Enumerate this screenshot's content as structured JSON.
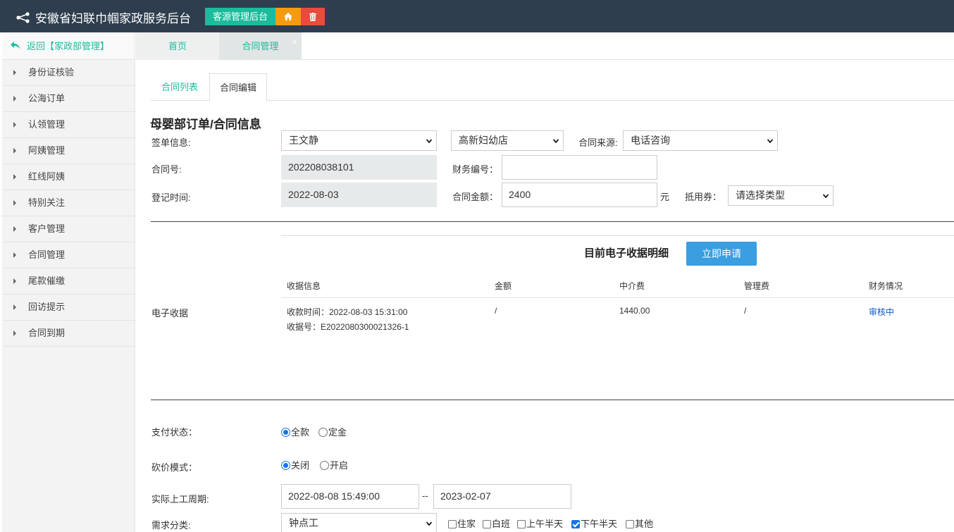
{
  "header": {
    "app_title": "安徽省妇联巾帼家政服务后台",
    "main_tag": "客源管理后台",
    "home_icon": "home-icon",
    "delete_icon": "trash-icon",
    "bg_color": "#2f3e4e"
  },
  "sidebar": {
    "back_label": "返回【家政部管理】",
    "items": [
      "身份证核验",
      "公海订单",
      "认领管理",
      "阿姨管理",
      "红线阿姨",
      "特别关注",
      "客户管理",
      "合同管理",
      "尾款催缴",
      "回访提示",
      "合同到期"
    ]
  },
  "tabs": [
    {
      "label": "首页"
    },
    {
      "label": "合同管理",
      "close": "×"
    }
  ],
  "subtabs": [
    {
      "label": "合同列表"
    },
    {
      "label": "合同编辑"
    }
  ],
  "form": {
    "title": "母婴部订单/合同信息",
    "sign_info_label": "签单信息:",
    "signer": "王文静",
    "store": "高新妇幼店",
    "source_label": "合同来源:",
    "source": "电话咨询",
    "contract_no_label": "合同号:",
    "contract_no": "202208038101",
    "finance_no_label": "财务编号：",
    "finance_no": "",
    "reg_time_label": "登记时间:",
    "reg_time": "2022-08-03",
    "amount_label": "合同金额：",
    "amount": "2400",
    "amount_unit": "元",
    "voucher_label": "抵用券：",
    "voucher": "请选择类型"
  },
  "receipt": {
    "section_label": "电子收据",
    "title": "目前电子收据明细",
    "apply_button": "立即申请",
    "columns": [
      "收据信息",
      "金额",
      "中介费",
      "管理费",
      "财务情况"
    ],
    "row": {
      "info_line1": "收款时间：2022-08-03 15:31:00",
      "info_line2": "收据号：E2022080300021326-1",
      "amount": "/",
      "agent_fee": "1440.00",
      "mgmt_fee": "/",
      "status": "审核中"
    }
  },
  "payment": {
    "label": "支付状态：",
    "options": [
      "全款",
      "定金"
    ],
    "selected": "全款"
  },
  "bargain": {
    "label": "砍价模式：",
    "options": [
      "关闭",
      "开启"
    ],
    "selected": "关闭"
  },
  "period": {
    "label": "实际上工周期:",
    "start": "2022-08-08 15:49:00",
    "separator": "--",
    "end": "2023-02-07"
  },
  "demand": {
    "label": "需求分类:",
    "value": "钟点工",
    "checkboxes": [
      {
        "label": "住家",
        "checked": false
      },
      {
        "label": "白班",
        "checked": false
      },
      {
        "label": "上午半天",
        "checked": false
      },
      {
        "label": "下午半天",
        "checked": true
      },
      {
        "label": "其他",
        "checked": false
      }
    ]
  }
}
